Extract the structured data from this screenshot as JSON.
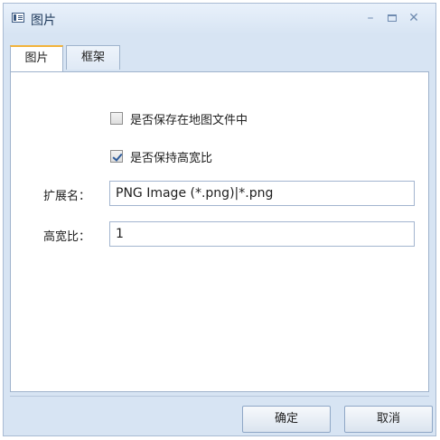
{
  "window": {
    "title": "图片"
  },
  "tabs": [
    {
      "label": "图片",
      "active": true
    },
    {
      "label": "框架",
      "active": false
    }
  ],
  "options": {
    "save_in_map": {
      "label": "是否保存在地图文件中",
      "checked": false
    },
    "keep_ratio": {
      "label": "是否保持高宽比",
      "checked": true
    }
  },
  "fields": {
    "extension": {
      "label": "扩展名：",
      "value": "PNG Image (*.png)|*.png"
    },
    "ratio": {
      "label": "高宽比：",
      "value": "1"
    }
  },
  "buttons": {
    "ok": "确定",
    "cancel": "取消"
  },
  "colors": {
    "accent": "#f2b33a",
    "frame": "#d7e4f3",
    "border": "#9fb3cc"
  }
}
